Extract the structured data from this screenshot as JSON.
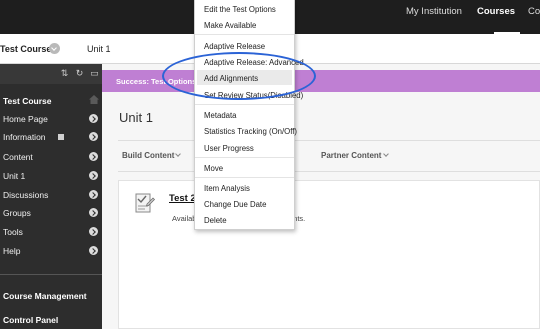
{
  "topnav": {
    "items": [
      {
        "label": "My Institution",
        "active": false
      },
      {
        "label": "Courses",
        "active": true
      },
      {
        "label": "Co",
        "active": false
      }
    ]
  },
  "breadcrumb": {
    "course": "Test Course",
    "current": "Unit 1"
  },
  "sidebar": {
    "course_title": "Test Course",
    "items": [
      {
        "label": "Home Page"
      },
      {
        "label": "Information"
      },
      {
        "label": "Content"
      },
      {
        "label": "Unit 1"
      },
      {
        "label": "Discussions"
      },
      {
        "label": "Groups"
      },
      {
        "label": "Tools"
      },
      {
        "label": "Help"
      }
    ],
    "management": [
      "Course Management",
      "Control Panel"
    ]
  },
  "success": {
    "text": "Success: Test Options"
  },
  "page": {
    "title": "Unit 1"
  },
  "actions": {
    "build": "Build Content",
    "partner": "Partner Content"
  },
  "content_item": {
    "title": "Test 2",
    "desc_start": "Availab",
    "desc_end": "ents."
  },
  "menu": {
    "items": [
      "Edit the Test Options",
      "Make Available",
      "Adaptive Release",
      "Adaptive Release: Advanced",
      "Add Alignments",
      "Set Review Status(Disabled)",
      "Metadata",
      "Statistics Tracking (On/Off)",
      "User Progress",
      "Move",
      "Item Analysis",
      "Change Due Date",
      "Delete"
    ],
    "highlighted": "Add Alignments"
  },
  "colors": {
    "success_bar": "#bf7fd3",
    "annotation_ellipse": "#2b63d6",
    "sidebar": "#2d2d2d",
    "topbar": "#1e1e1e"
  }
}
